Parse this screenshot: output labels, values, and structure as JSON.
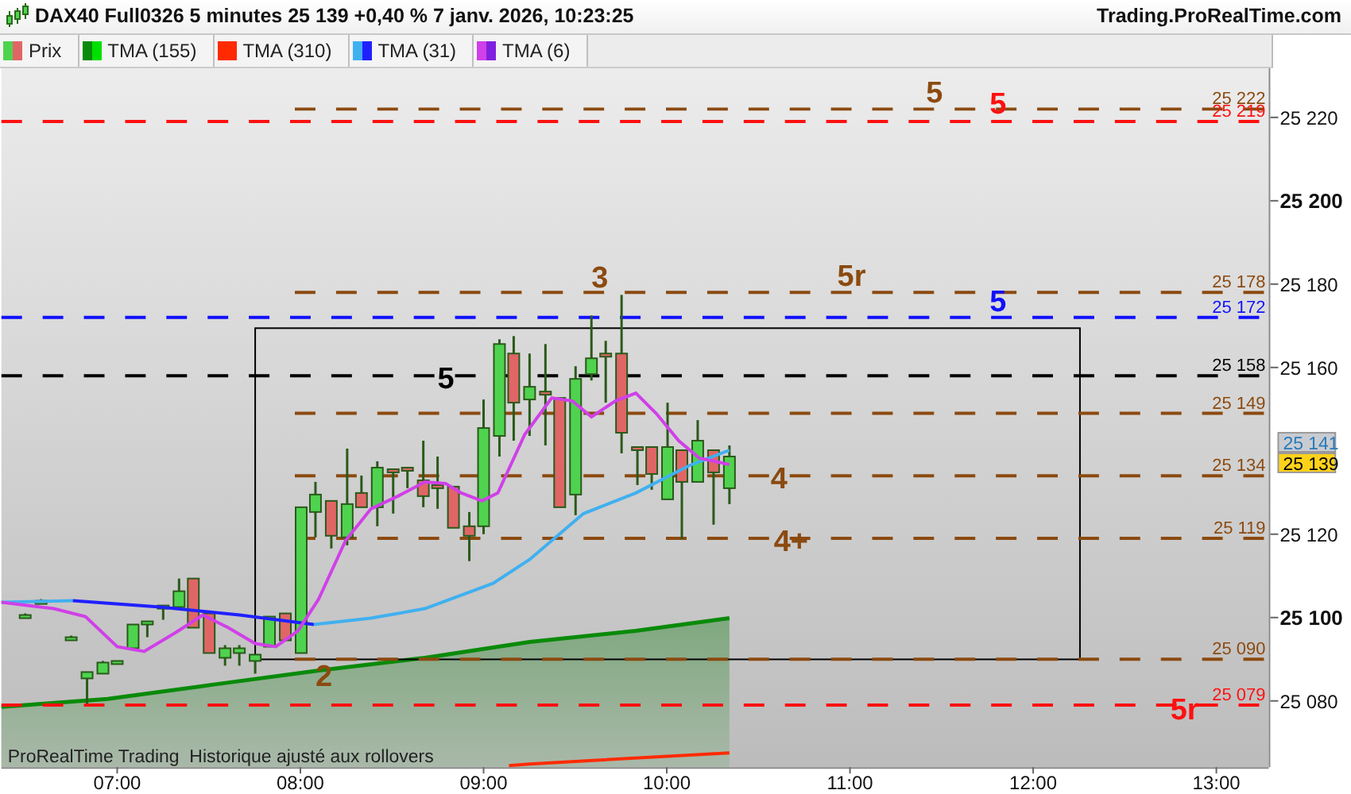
{
  "title_bar": {
    "title": "DAX40 Full0326 5 minutes 25 139 +0,40 % 7 janv. 2026, 10:23:25",
    "site": "Trading.ProRealTime.com"
  },
  "legend": [
    {
      "label": "Prix",
      "swatches": [
        {
          "color": "#4fd34f"
        },
        {
          "color": "#e06666"
        }
      ]
    },
    {
      "label": "TMA (155)",
      "swatches": [
        {
          "color": "#0a8a0a"
        },
        {
          "color": "#00e000"
        }
      ]
    },
    {
      "label": "TMA (310)",
      "swatches": [
        {
          "color": "#ff2a00"
        },
        {
          "color": "#ff2a00"
        }
      ]
    },
    {
      "label": "TMA (31)",
      "swatches": [
        {
          "color": "#40b0f0"
        },
        {
          "color": "#2020ff"
        }
      ]
    },
    {
      "label": "TMA (6)",
      "swatches": [
        {
          "color": "#d040e8"
        },
        {
          "color": "#8020e0"
        }
      ]
    }
  ],
  "levels": [
    {
      "value": "25 222",
      "color": "#8b4a10",
      "tags": [
        "5"
      ]
    },
    {
      "value": "25 219",
      "color": "#ff1010",
      "tags": [
        "5"
      ]
    },
    {
      "value": "25 178",
      "color": "#8b4a10",
      "tags": [
        "3",
        "5r"
      ]
    },
    {
      "value": "25 172",
      "color": "#1010ff",
      "tags": [
        "5"
      ]
    },
    {
      "value": "25 158",
      "color": "#000000",
      "tags": [
        "5"
      ]
    },
    {
      "value": "25 149",
      "color": "#8b4a10"
    },
    {
      "value": "25 134",
      "color": "#8b4a10",
      "tags": [
        "4"
      ]
    },
    {
      "value": "25 119",
      "color": "#8b4a10",
      "tags": [
        "4+"
      ]
    },
    {
      "value": "25 090",
      "color": "#8b4a10",
      "tags": [
        "2"
      ]
    },
    {
      "value": "25 079",
      "color": "#ff1010",
      "tags": [
        "5r"
      ]
    }
  ],
  "price_badges": [
    {
      "text": "25 141",
      "kind": "indicator"
    },
    {
      "text": "25 139",
      "kind": "last"
    }
  ],
  "y_axis": [
    {
      "label": "25 220",
      "major": false
    },
    {
      "label": "25 200",
      "major": true
    },
    {
      "label": "25 180",
      "major": false
    },
    {
      "label": "25 160",
      "major": false
    },
    {
      "label": "25 120",
      "major": false
    },
    {
      "label": "25 100",
      "major": true
    },
    {
      "label": "25 080",
      "major": false
    }
  ],
  "x_axis": [
    "07:00",
    "08:00",
    "09:00",
    "10:00",
    "11:00",
    "12:00",
    "13:00"
  ],
  "footer_note": "ProRealTime Trading  Historique ajusté aux rollovers"
}
